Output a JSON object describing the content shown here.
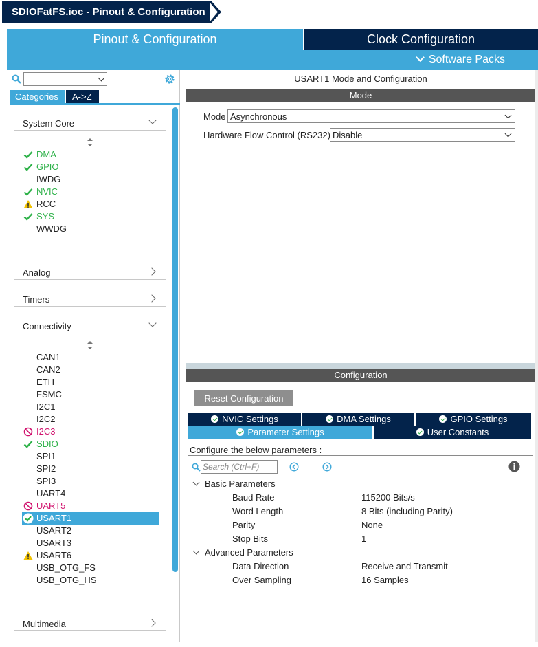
{
  "title": "SDIOFatFS.ioc - Pinout & Configuration",
  "main_tabs": {
    "pinout": "Pinout & Configuration",
    "clock": "Clock Configuration"
  },
  "software_packs": "Software Packs",
  "left": {
    "tabs": {
      "categories": "Categories",
      "az": "A->Z"
    },
    "system_core": {
      "label": "System Core",
      "items": [
        {
          "label": "DMA",
          "status": "ok"
        },
        {
          "label": "GPIO",
          "status": "ok"
        },
        {
          "label": "IWDG",
          "status": "none"
        },
        {
          "label": "NVIC",
          "status": "ok"
        },
        {
          "label": "RCC",
          "status": "warn"
        },
        {
          "label": "SYS",
          "status": "ok"
        },
        {
          "label": "WWDG",
          "status": "none"
        }
      ]
    },
    "analog": "Analog",
    "timers": "Timers",
    "connectivity": {
      "label": "Connectivity",
      "items": [
        {
          "label": "CAN1",
          "status": "none"
        },
        {
          "label": "CAN2",
          "status": "none"
        },
        {
          "label": "ETH",
          "status": "none"
        },
        {
          "label": "FSMC",
          "status": "none"
        },
        {
          "label": "I2C1",
          "status": "none"
        },
        {
          "label": "I2C2",
          "status": "none"
        },
        {
          "label": "I2C3",
          "status": "err"
        },
        {
          "label": "SDIO",
          "status": "ok"
        },
        {
          "label": "SPI1",
          "status": "none"
        },
        {
          "label": "SPI2",
          "status": "none"
        },
        {
          "label": "SPI3",
          "status": "none"
        },
        {
          "label": "UART4",
          "status": "none"
        },
        {
          "label": "UART5",
          "status": "err"
        },
        {
          "label": "USART1",
          "status": "selected"
        },
        {
          "label": "USART2",
          "status": "none"
        },
        {
          "label": "USART3",
          "status": "none"
        },
        {
          "label": "USART6",
          "status": "warn"
        },
        {
          "label": "USB_OTG_FS",
          "status": "none"
        },
        {
          "label": "USB_OTG_HS",
          "status": "none"
        }
      ]
    },
    "multimedia": "Multimedia"
  },
  "right": {
    "header": "USART1 Mode and Configuration",
    "mode_bar": "Mode",
    "mode_label": "Mode",
    "mode_value": "Asynchronous",
    "hfc_label": "Hardware Flow Control (RS232)",
    "hfc_value": "Disable",
    "config_bar": "Configuration",
    "reset_button": "Reset Configuration",
    "tabs": {
      "nvic": "NVIC Settings",
      "dma": "DMA Settings",
      "gpio": "GPIO Settings",
      "params": "Parameter Settings",
      "user": "User Constants"
    },
    "description": "Configure the below parameters :",
    "search_placeholder": "Search (Ctrl+F)",
    "basic": {
      "label": "Basic Parameters",
      "rows": [
        {
          "name": "Baud Rate",
          "value": "115200 Bits/s"
        },
        {
          "name": "Word Length",
          "value": "8 Bits (including Parity)"
        },
        {
          "name": "Parity",
          "value": "None"
        },
        {
          "name": "Stop Bits",
          "value": "1"
        }
      ]
    },
    "advanced": {
      "label": "Advanced Parameters",
      "rows": [
        {
          "name": "Data Direction",
          "value": "Receive and Transmit"
        },
        {
          "name": "Over Sampling",
          "value": "16 Samples"
        }
      ]
    }
  },
  "colors": {
    "navy": "#03234b",
    "accent": "#3fa8d9",
    "ok": "#2fb24a",
    "warn": "#f2c200",
    "err": "#d0126d"
  }
}
